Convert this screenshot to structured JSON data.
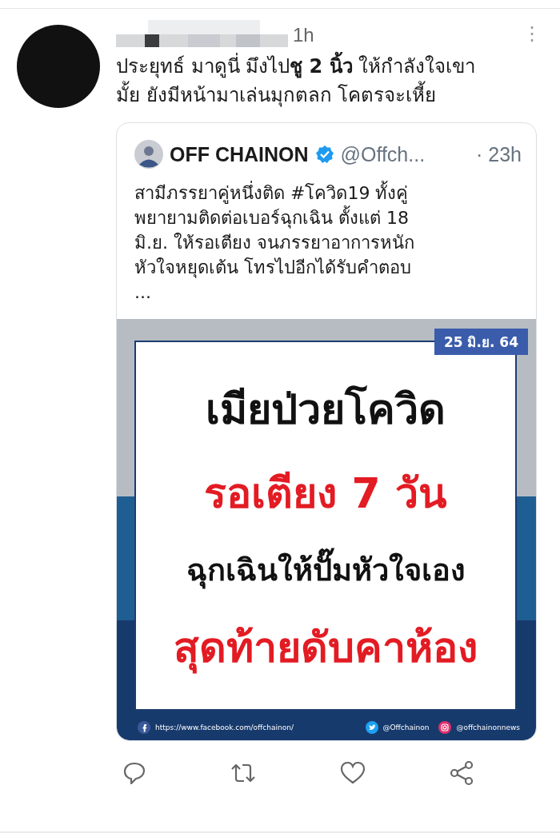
{
  "tweet": {
    "time": "1h",
    "more_menu": "⋮",
    "text": "ประยุทธ์ มาดูนี่ มึงไป**ชู 2 นิ้ว** ให้กำลังใจเขา\nมั้ย ยังมีหน้ามาเล่นมุกตลก โคตรจะเหี้ย"
  },
  "quote": {
    "author": "OFF CHAINON",
    "verified": true,
    "handle": "@Offch...",
    "time": "· 23h",
    "text": "สามีภรรยาคู่หนึ่งติด #โควิด19 ทั้งคู่\nพยายามติดต่อเบอร์ฉุกเฉิน ตั้งแต่ 18\nมิ.ย. ให้รอเตียง จนภรรยาอาการหนัก\nหัวใจหยุดเต้น โทรไปอีกได้รับคำตอบ\n..."
  },
  "graphic": {
    "date": "25 มิ.ย. 64",
    "lines": [
      {
        "kind": "headline",
        "text": "เมียป่วยโควิด",
        "color": "#111111"
      },
      {
        "kind": "headline",
        "text": "รอเตียง 7 วัน",
        "color": "#e31b23"
      },
      {
        "kind": "subline",
        "text": "ฉุกเฉินให้ปั๊มหัวใจเอง",
        "color": "#111111"
      },
      {
        "kind": "headline",
        "text": "สุดท้ายดับคาห้อง",
        "color": "#e31b23"
      }
    ],
    "footer": [
      {
        "kind": "facebook",
        "text": "https://www.facebook.com/offchainon/"
      },
      {
        "kind": "twitter",
        "text": "@Offchainon"
      },
      {
        "kind": "instagram",
        "text": "@offchainonnews"
      }
    ]
  },
  "actions": [
    {
      "kind": "reply"
    },
    {
      "kind": "retweet"
    },
    {
      "kind": "like"
    },
    {
      "kind": "share"
    }
  ]
}
